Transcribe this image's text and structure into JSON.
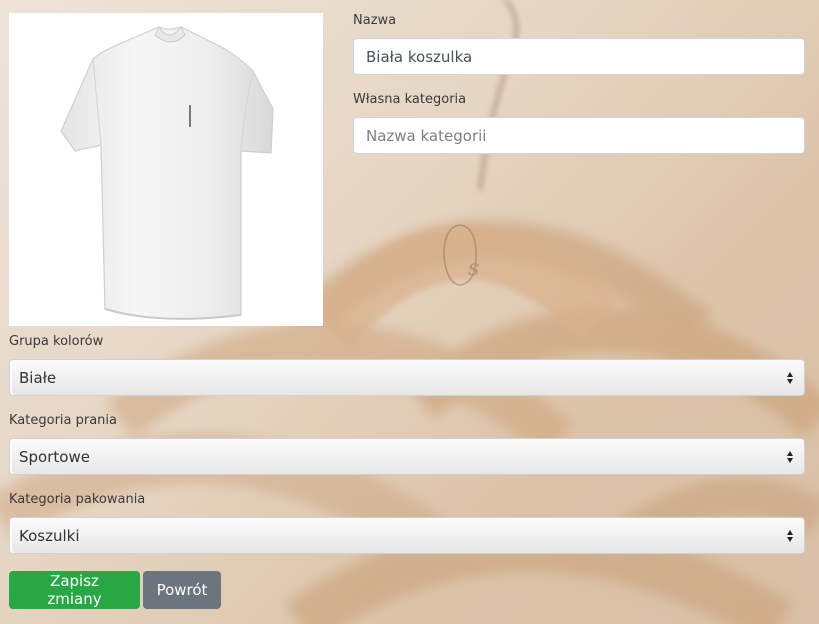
{
  "form": {
    "name_label": "Nazwa",
    "name_value": "Biała koszulka",
    "custom_category_label": "Własna kategoria",
    "custom_category_placeholder": "Nazwa kategorii",
    "color_group_label": "Grupa kolorów",
    "color_group_value": "Białe",
    "washing_category_label": "Kategoria prania",
    "washing_category_value": "Sportowe",
    "packing_category_label": "Kategoria pakowania",
    "packing_category_value": "Koszulki"
  },
  "buttons": {
    "save_label": "Zapisz zmiany",
    "back_label": "Powrót"
  },
  "colors": {
    "save": "#28a745",
    "back": "#6c757d"
  }
}
